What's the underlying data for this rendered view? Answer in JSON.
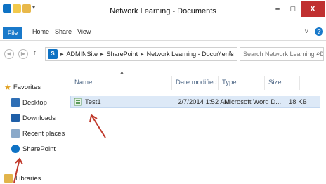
{
  "window": {
    "title": "Network Learning - Documents",
    "minimize_glyph": "–",
    "maximize_glyph": "□",
    "close_glyph": "X"
  },
  "ribbon": {
    "tabs": [
      "File",
      "Home",
      "Share",
      "View"
    ],
    "expand_glyph": "˅",
    "help_glyph": "?"
  },
  "nav": {
    "back_glyph": "◀",
    "forward_glyph": "▶",
    "up_glyph": "↑"
  },
  "address": {
    "crumbs": [
      "ADMINSite",
      "SharePoint",
      "Network Learning - Documents"
    ],
    "separator": "▸",
    "dropdown_glyph": "˅",
    "refresh_glyph": "↻"
  },
  "search": {
    "placeholder": "Search Network Learning - Do...",
    "icon_glyph": "⌕"
  },
  "sidebar": {
    "favorites_label": "Favorites",
    "items": [
      {
        "label": "Desktop"
      },
      {
        "label": "Downloads"
      },
      {
        "label": "Recent places"
      },
      {
        "label": "SharePoint"
      }
    ],
    "libraries_label": "Libraries"
  },
  "columns": {
    "name": "Name",
    "date": "Date modified",
    "type": "Type",
    "size": "Size"
  },
  "files": [
    {
      "name": "Test1",
      "date": "2/7/2014 1:52 AM",
      "type": "Microsoft Word D...",
      "size": "18 KB"
    }
  ],
  "colors": {
    "file_tab": "#1979ca",
    "selection": "#dde9f7",
    "arrow": "#c0392b",
    "close": "#c03030"
  }
}
